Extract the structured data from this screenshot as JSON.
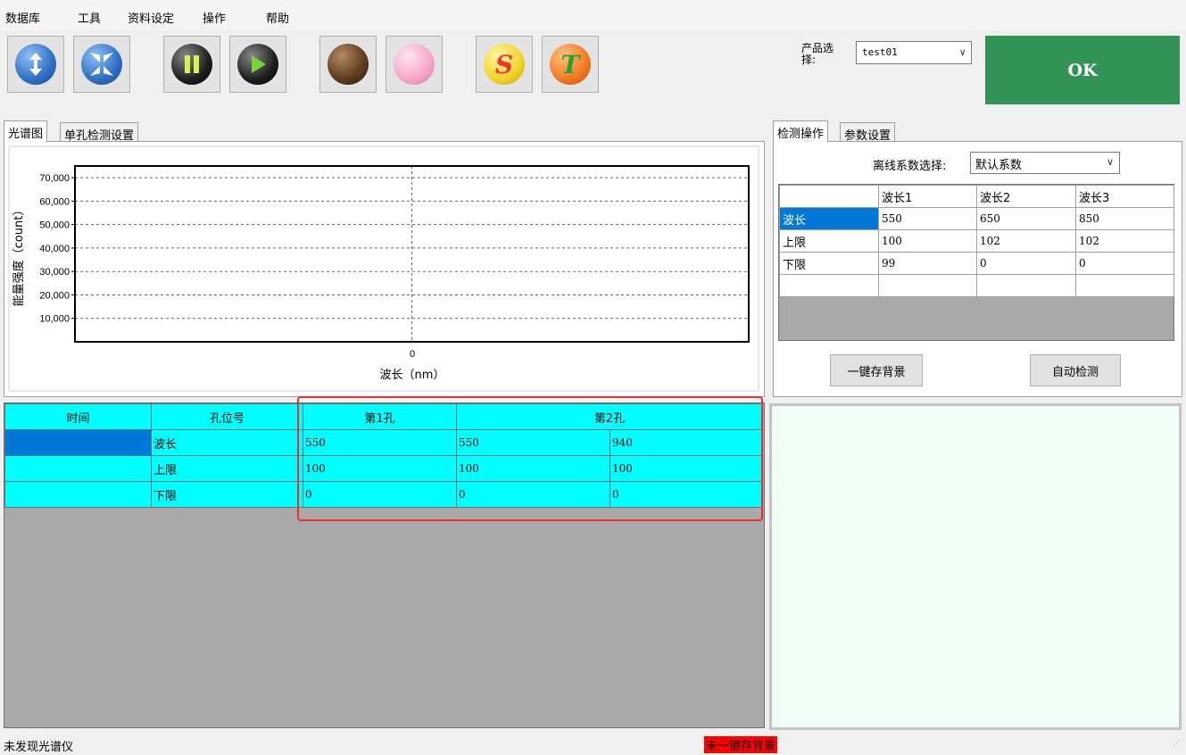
{
  "menu": [
    "数据库",
    "工具",
    "资料设定",
    "操作",
    "帮助"
  ],
  "toolbar": {
    "buttons": [
      {
        "name": "updown-icon",
        "color": "#2f6fc2"
      },
      {
        "name": "collapse-icon",
        "color": "#2f6fc2"
      },
      {
        "name": "pause-icon",
        "color": "#1e1e1e"
      },
      {
        "name": "play-icon",
        "color": "#1e1e1e"
      },
      {
        "name": "brown-ball-icon",
        "color": "#5c3a1e"
      },
      {
        "name": "pink-ball-icon",
        "color": "#f4a6c8"
      },
      {
        "name": "s-ball-icon",
        "color": "#f2d22a",
        "letter": "S"
      },
      {
        "name": "t-ball-icon",
        "color": "#f07a22",
        "letter": "T"
      }
    ]
  },
  "product": {
    "label": "产品选择:",
    "value": "test01"
  },
  "ok_label": "OK",
  "left_tabs": [
    "光谱图",
    "单孔检测设置"
  ],
  "right_tabs": [
    "检测操作",
    "参数设置"
  ],
  "chart_data": {
    "type": "line",
    "xlabel": "波长（nm）",
    "ylabel": "能量强度（count）",
    "x_ticks": [
      "0"
    ],
    "y_ticks": [
      "10,000",
      "20,000",
      "30,000",
      "40,000",
      "50,000",
      "60,000",
      "70,000"
    ],
    "ylim": [
      0,
      75000
    ],
    "grid": true,
    "series": []
  },
  "coeff": {
    "label": "离线系数选择:",
    "value": "默认系数"
  },
  "right_grid": {
    "headers": [
      "",
      "波长1",
      "波长2",
      "波长3"
    ],
    "rows": [
      [
        "波长",
        "550",
        "650",
        "850"
      ],
      [
        "上限",
        "100",
        "102",
        "102"
      ],
      [
        "下限",
        "99",
        "0",
        "0"
      ],
      [
        "",
        "",
        "",
        ""
      ]
    ]
  },
  "buttons": {
    "save_bg": "一键存背景",
    "auto_detect": "自动检测"
  },
  "left_grid": {
    "headers": [
      "时间",
      "孔位号",
      "第1孔",
      "第2孔"
    ],
    "rows": [
      [
        "",
        "波长",
        "550",
        "550",
        "940"
      ],
      [
        "",
        "上限",
        "100",
        "100",
        "100"
      ],
      [
        "",
        "下限",
        "0",
        "0",
        "0"
      ]
    ]
  },
  "status": {
    "left": "未发现光谱仪",
    "center": "未一键存背景",
    "center_color": "#ff0000"
  }
}
